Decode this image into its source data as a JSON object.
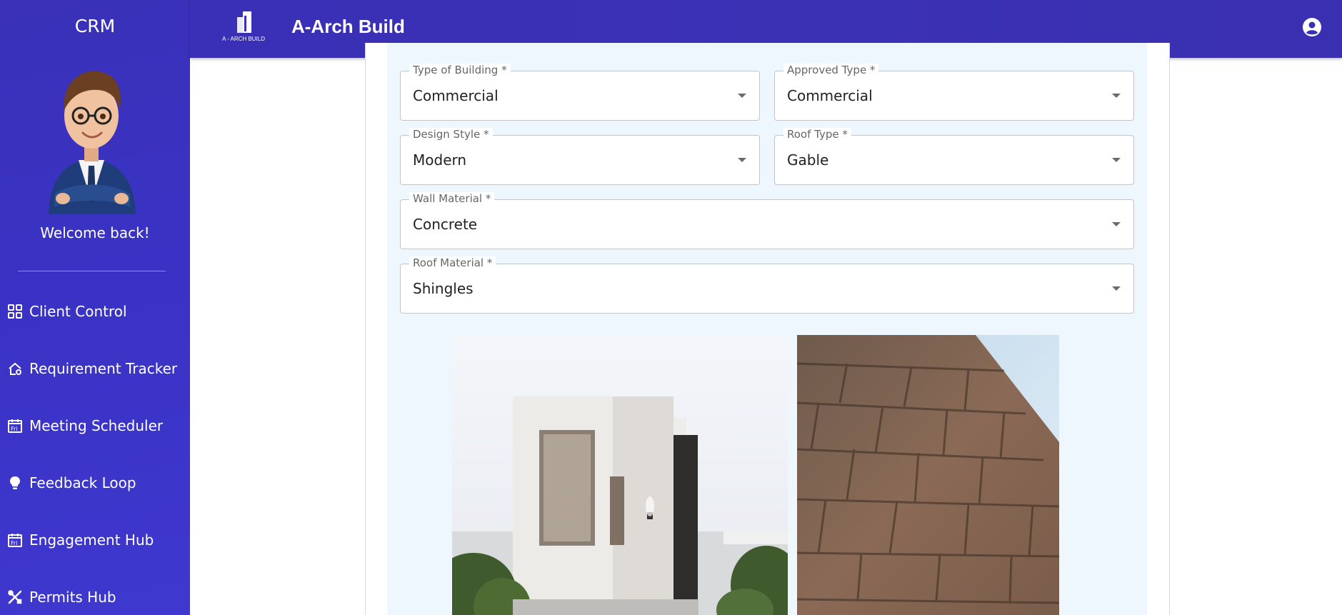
{
  "sidebar": {
    "title": "CRM",
    "welcome": "Welcome back!",
    "items": [
      {
        "label": "Client Control",
        "icon": "dashboard-grid-icon"
      },
      {
        "label": "Requirement Tracker",
        "icon": "house-gear-icon"
      },
      {
        "label": "Meeting Scheduler",
        "icon": "calendar-icon"
      },
      {
        "label": "Feedback Loop",
        "icon": "lightbulb-icon"
      },
      {
        "label": "Engagement Hub",
        "icon": "calendar-icon"
      },
      {
        "label": "Permits Hub",
        "icon": "tools-icon"
      }
    ]
  },
  "header": {
    "logo_text": "A - ARCH BUILD",
    "title": "A-Arch Build"
  },
  "form": {
    "type_of_building": {
      "label": "Type of Building *",
      "value": "Commercial"
    },
    "approved_type": {
      "label": "Approved Type *",
      "value": "Commercial"
    },
    "design_style": {
      "label": "Design Style *",
      "value": "Modern"
    },
    "roof_type": {
      "label": "Roof Type *",
      "value": "Gable"
    },
    "wall_material": {
      "label": "Wall Material *",
      "value": "Concrete"
    },
    "roof_material": {
      "label": "Roof Material *",
      "value": "Shingles"
    }
  },
  "colors": {
    "sidebar_bg": "#3a31b8",
    "topbar_bg": "#3a2fb7",
    "panel_bg": "#eef6fe"
  }
}
